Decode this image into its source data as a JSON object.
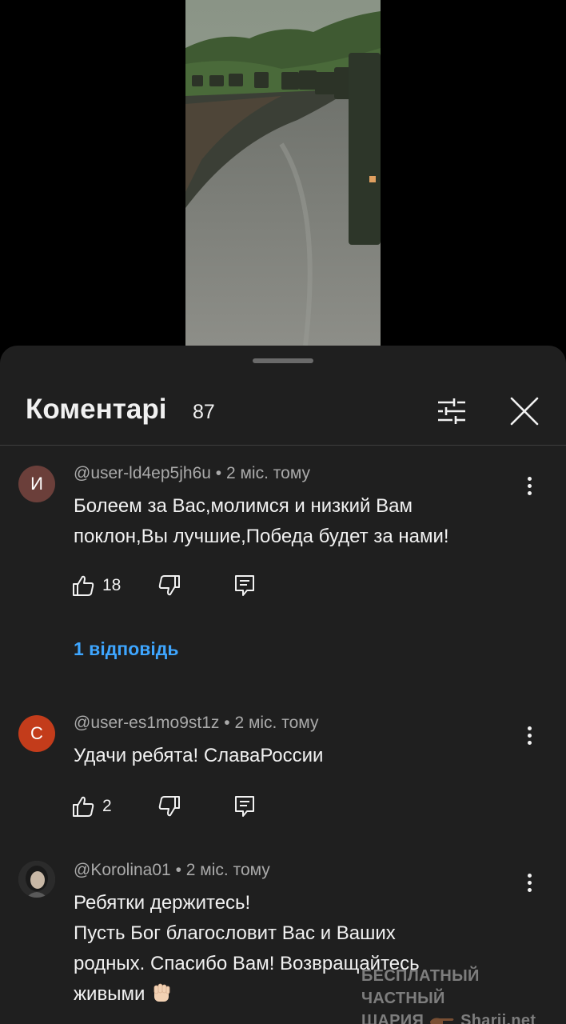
{
  "video": {
    "description_icon": "video-frame-image"
  },
  "comments_panel": {
    "title": "Коментарі",
    "count": "87",
    "filter_icon": "sliders-icon",
    "close_icon": "close-icon"
  },
  "comments": [
    {
      "avatar_letter": "И",
      "avatar_color": "#6b3f3a",
      "author": "@user-ld4ep5jh6u",
      "time": "2 міс. тому",
      "lines": [
        "Болеем за Вас,молимся и низкий Вам",
        "поклон,Вы лучшие,Победа будет за нами!"
      ],
      "likes": "18",
      "replies": "1 відповідь"
    },
    {
      "avatar_letter": "С",
      "avatar_color": "#c33c1b",
      "author": "@user-es1mo9st1z",
      "time": "2 міс. тому",
      "lines": [
        "Удачи ребята! СлаваРоссии"
      ],
      "likes": "2"
    },
    {
      "author": "@Korolina01",
      "time": "2 міс. тому",
      "lines": [
        "Ребятки держитесь!",
        "Пусть Бог благословит Вас и Ваших",
        "родных. Спасибо Вам! Возвращайтесь",
        "живыми"
      ]
    }
  ],
  "separator": "•",
  "watermark": {
    "line1": "БЕСПЛАТНЫЙ ЧАСТНЫЙ",
    "line2_word": "ШАРИЯ",
    "line2_site": "Sharij.net"
  }
}
